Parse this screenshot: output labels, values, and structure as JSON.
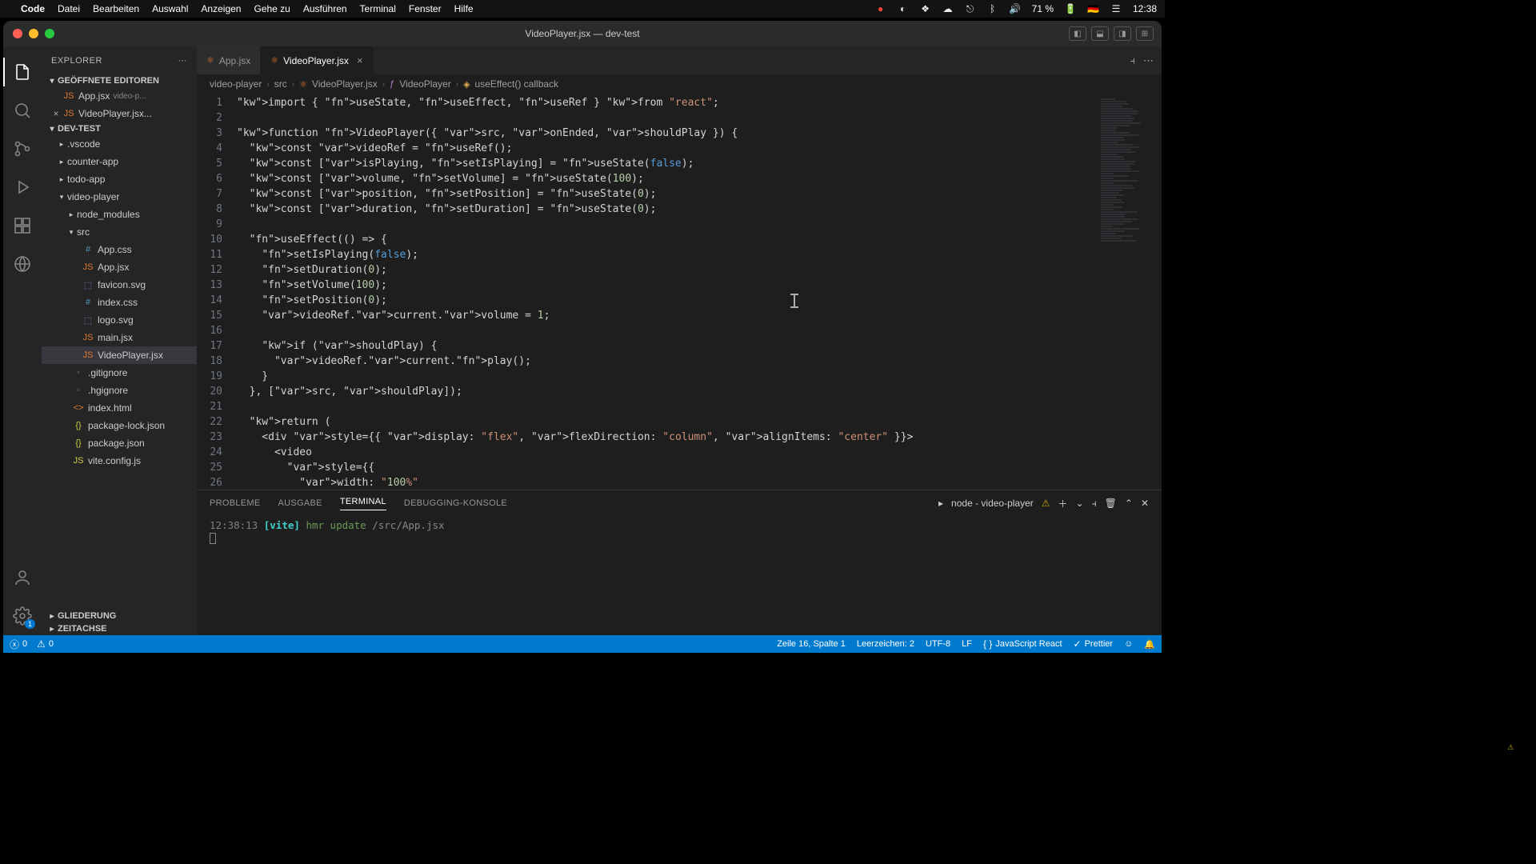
{
  "menubar": {
    "app": "Code",
    "items": [
      "Datei",
      "Bearbeiten",
      "Auswahl",
      "Anzeigen",
      "Gehe zu",
      "Ausführen",
      "Terminal",
      "Fenster",
      "Hilfe"
    ],
    "battery": "71 %",
    "time": "12:38",
    "flag": "🇩🇪"
  },
  "window": {
    "title": "VideoPlayer.jsx — dev-test"
  },
  "sidebar": {
    "title": "EXPLORER",
    "openEditors": {
      "label": "GEÖFFNETE EDITOREN",
      "items": [
        {
          "name": "App.jsx",
          "hint": "video-p..."
        },
        {
          "name": "VideoPlayer.jsx...",
          "close": true
        }
      ]
    },
    "project": {
      "label": "DEV-TEST",
      "folders": [
        {
          "name": ".vscode",
          "depth": 1,
          "expanded": false
        },
        {
          "name": "counter-app",
          "depth": 1,
          "expanded": false
        },
        {
          "name": "todo-app",
          "depth": 1,
          "expanded": false
        },
        {
          "name": "video-player",
          "depth": 1,
          "expanded": true
        },
        {
          "name": "node_modules",
          "depth": 2,
          "expanded": false
        },
        {
          "name": "src",
          "depth": 2,
          "expanded": true
        }
      ],
      "files": [
        {
          "name": "App.css",
          "depth": 3,
          "ico": "#",
          "color": "#519aba"
        },
        {
          "name": "App.jsx",
          "depth": 3,
          "ico": "JS",
          "color": "#e37933"
        },
        {
          "name": "favicon.svg",
          "depth": 3,
          "ico": "⬚",
          "color": "#a074c4"
        },
        {
          "name": "index.css",
          "depth": 3,
          "ico": "#",
          "color": "#519aba"
        },
        {
          "name": "logo.svg",
          "depth": 3,
          "ico": "⬚",
          "color": "#a074c4"
        },
        {
          "name": "main.jsx",
          "depth": 3,
          "ico": "JS",
          "color": "#e37933"
        },
        {
          "name": "VideoPlayer.jsx",
          "depth": 3,
          "ico": "JS",
          "color": "#e37933",
          "selected": true
        },
        {
          "name": ".gitignore",
          "depth": 2,
          "ico": "◦",
          "color": "#6d8086"
        },
        {
          "name": ".hgignore",
          "depth": 2,
          "ico": "◦",
          "color": "#6d8086"
        },
        {
          "name": "index.html",
          "depth": 2,
          "ico": "<>",
          "color": "#e37933"
        },
        {
          "name": "package-lock.json",
          "depth": 2,
          "ico": "{}",
          "color": "#cbcb41"
        },
        {
          "name": "package.json",
          "depth": 2,
          "ico": "{}",
          "color": "#cbcb41"
        },
        {
          "name": "vite.config.js",
          "depth": 2,
          "ico": "JS",
          "color": "#cbcb41"
        }
      ]
    },
    "outline": "GLIEDERUNG",
    "timeline": "ZEITACHSE"
  },
  "tabs": [
    {
      "name": "App.jsx",
      "active": false
    },
    {
      "name": "VideoPlayer.jsx",
      "active": true
    }
  ],
  "breadcrumb": [
    "video-player",
    "src",
    "VideoPlayer.jsx",
    "VideoPlayer",
    "useEffect() callback"
  ],
  "code": {
    "lines": [
      "import { useState, useEffect, useRef } from \"react\";",
      "",
      "function VideoPlayer({ src, onEnded, shouldPlay }) {",
      "  const videoRef = useRef();",
      "  const [isPlaying, setIsPlaying] = useState(false);",
      "  const [volume, setVolume] = useState(100);",
      "  const [position, setPosition] = useState(0);",
      "  const [duration, setDuration] = useState(0);",
      "",
      "  useEffect(() => {",
      "    setIsPlaying(false);",
      "    setDuration(0);",
      "    setVolume(100);",
      "    setPosition(0);",
      "    videoRef.current.volume = 1;",
      "",
      "    if (shouldPlay) {",
      "      videoRef.current.play();",
      "    }",
      "  }, [src, shouldPlay]);",
      "",
      "  return (",
      "    <div style={{ display: \"flex\", flexDirection: \"column\", alignItems: \"center\" }}>",
      "      <video",
      "        style={{",
      "          width: \"100%\""
    ],
    "firstLine": 1
  },
  "panel": {
    "tabs": [
      "PROBLEME",
      "AUSGABE",
      "TERMINAL",
      "DEBUGGING-KONSOLE"
    ],
    "activeTab": 2,
    "terminalLabel": "node - video-player",
    "terminal": {
      "time": "12:38:13",
      "tag": "[vite]",
      "msg": "hmr update",
      "path": "/src/App.jsx"
    }
  },
  "statusbar": {
    "errors": "0",
    "warnings": "0",
    "pos": "Zeile 16, Spalte 1",
    "indent": "Leerzeichen: 2",
    "encoding": "UTF-8",
    "eol": "LF",
    "lang": "JavaScript React",
    "prettier": "Prettier"
  },
  "activity": {
    "settingsBadge": "1"
  }
}
